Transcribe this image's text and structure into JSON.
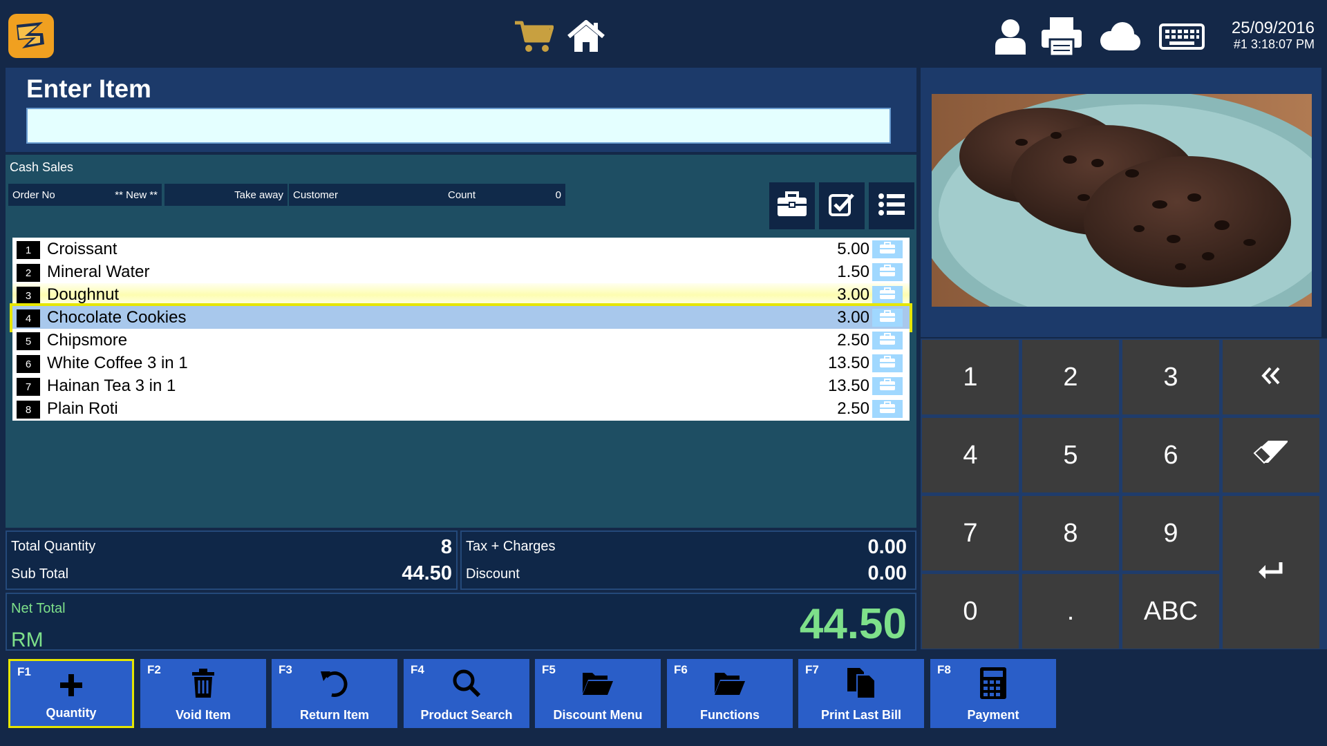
{
  "header": {
    "date": "25/09/2016",
    "terminal_time": "#1  3:18:07 PM",
    "icons": [
      "logo-icon",
      "cart-icon",
      "home-icon",
      "user-icon",
      "printer-icon",
      "cloud-icon",
      "keyboard-icon"
    ]
  },
  "entry": {
    "title": "Enter Item",
    "input_value": ""
  },
  "order": {
    "mode": "Cash Sales",
    "order_no_label": "Order No",
    "order_no_value": "** New **",
    "take_away": "Take away",
    "customer_label": "Customer",
    "count_label": "Count",
    "count_value": "0",
    "items": [
      {
        "no": "1",
        "name": "Croissant",
        "price": "5.00"
      },
      {
        "no": "2",
        "name": "Mineral Water",
        "price": "1.50"
      },
      {
        "no": "3",
        "name": "Doughnut",
        "price": "3.00"
      },
      {
        "no": "4",
        "name": "Chocolate Cookies",
        "price": "3.00"
      },
      {
        "no": "5",
        "name": "Chipsmore",
        "price": "2.50"
      },
      {
        "no": "6",
        "name": "White Coffee 3 in 1",
        "price": "13.50"
      },
      {
        "no": "7",
        "name": "Hainan Tea 3 in 1",
        "price": "13.50"
      },
      {
        "no": "8",
        "name": "Plain Roti",
        "price": "2.50"
      }
    ],
    "selected_index": 3
  },
  "totals": {
    "total_quantity_label": "Total Quantity",
    "total_quantity": "8",
    "sub_total_label": "Sub Total",
    "sub_total": "44.50",
    "tax_label": "Tax + Charges",
    "tax": "0.00",
    "discount_label": "Discount",
    "discount": "0.00",
    "net_total_label": "Net Total",
    "currency": "RM",
    "net_total": "44.50"
  },
  "numpad": {
    "keys": [
      "1",
      "2",
      "3",
      "4",
      "5",
      "6",
      "7",
      "8",
      "9",
      "0",
      ".",
      "ABC"
    ]
  },
  "function_keys": [
    {
      "key": "F1",
      "label": "Quantity"
    },
    {
      "key": "F2",
      "label": "Void Item"
    },
    {
      "key": "F3",
      "label": "Return Item"
    },
    {
      "key": "F4",
      "label": "Product Search"
    },
    {
      "key": "F5",
      "label": "Discount Menu"
    },
    {
      "key": "F6",
      "label": "Functions"
    },
    {
      "key": "F7",
      "label": "Print Last Bill"
    },
    {
      "key": "F8",
      "label": "Payment"
    }
  ],
  "colors": {
    "background": "#142848",
    "panel": "#1c3a6a",
    "order_area": "#1e4e63",
    "net_total": "#7ee08a",
    "function_key": "#2a5ec8",
    "highlight": "#e6e600",
    "cart_icon": "#c8a040"
  }
}
